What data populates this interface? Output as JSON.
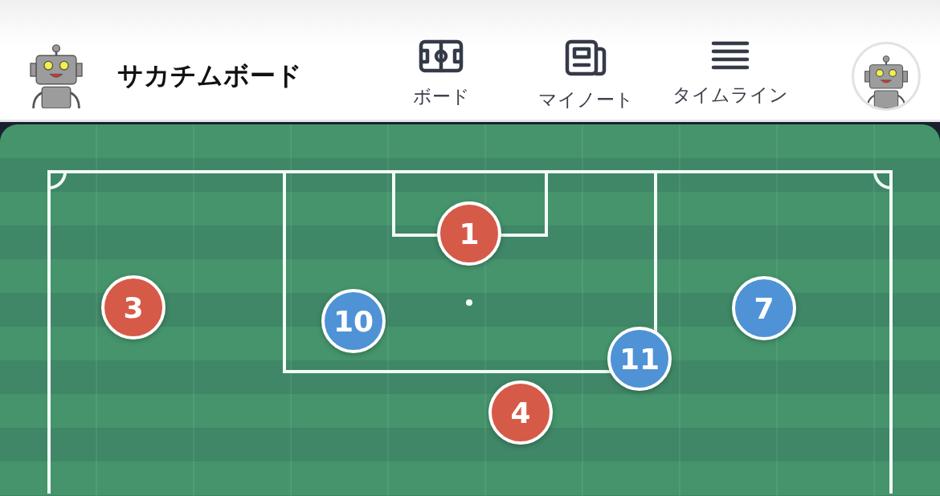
{
  "header": {
    "title": "サカチムボード"
  },
  "nav": [
    {
      "kind": "pitch",
      "label": "ボード"
    },
    {
      "kind": "note",
      "label": "マイノート"
    },
    {
      "kind": "list",
      "label": "タイムライン"
    }
  ],
  "players": [
    {
      "number": "1",
      "color": "#d65a48"
    },
    {
      "number": "3",
      "color": "#d65a48"
    },
    {
      "number": "10",
      "color": "#4f93d6"
    },
    {
      "number": "7",
      "color": "#4f93d6"
    },
    {
      "number": "11",
      "color": "#4f93d6"
    },
    {
      "number": "4",
      "color": "#d65a48"
    }
  ]
}
